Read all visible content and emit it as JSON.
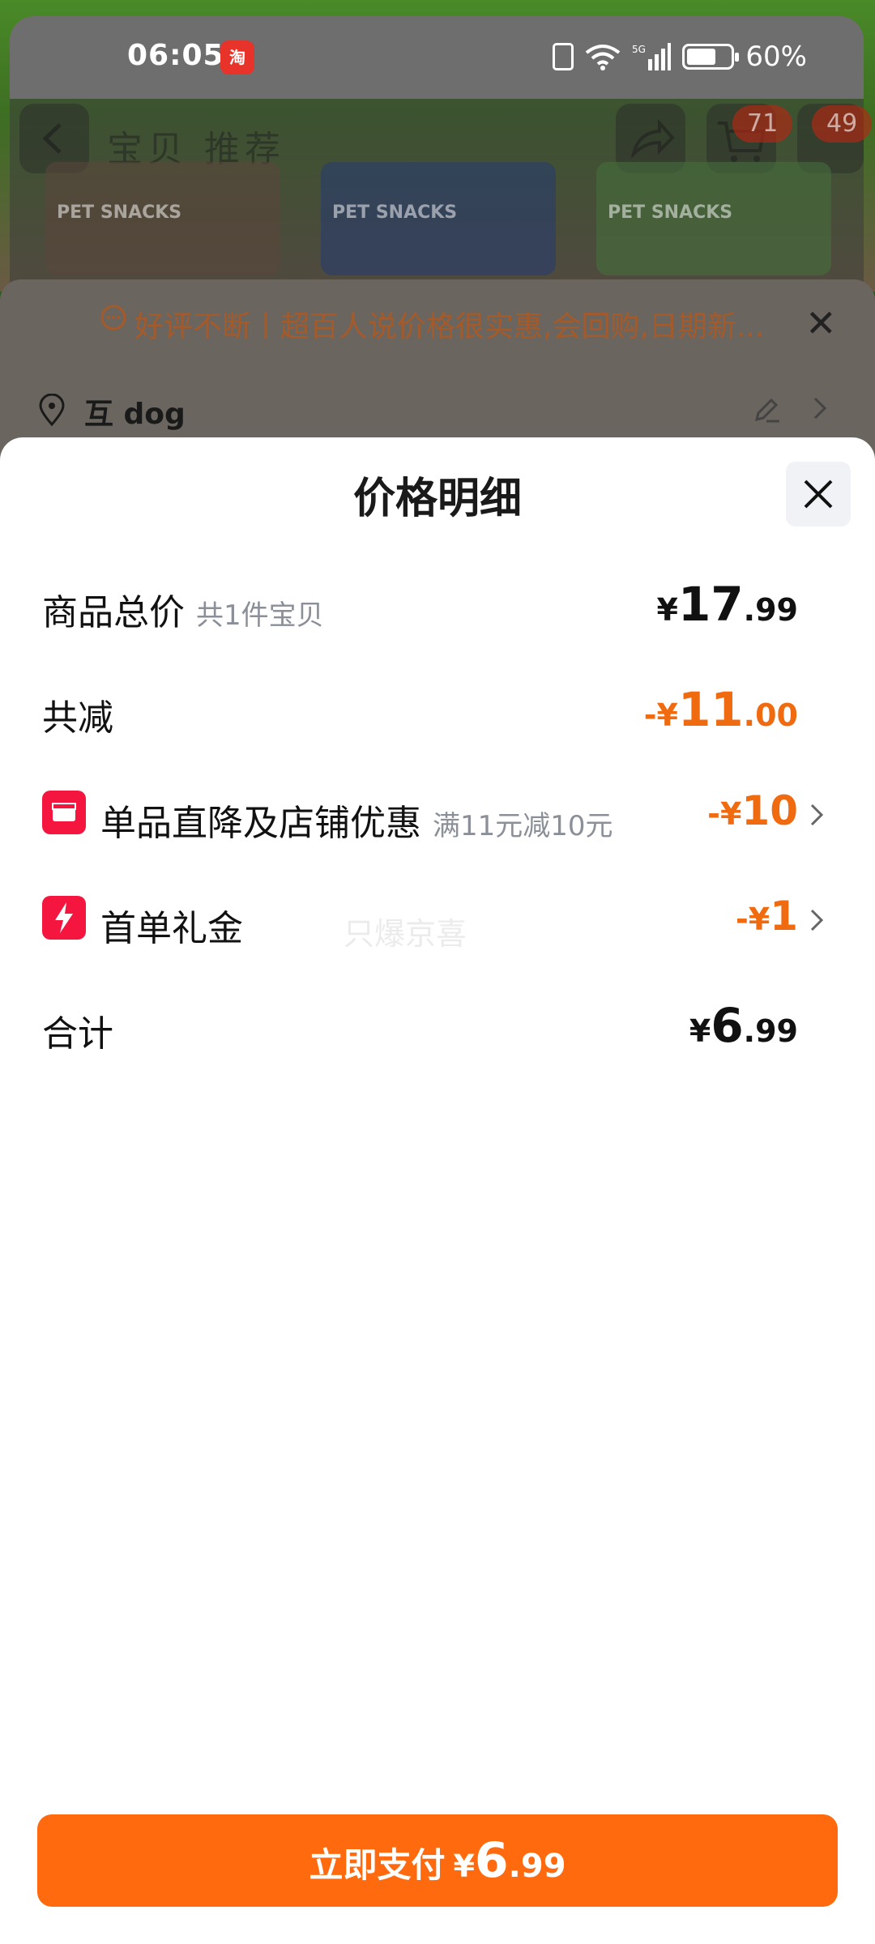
{
  "status_bar": {
    "time": "06:05",
    "app_icon_text": "淘",
    "network": "5G",
    "battery": "60%"
  },
  "background": {
    "nav_title": "宝贝 推荐",
    "cart_badge": "71",
    "msg_badge": "49",
    "product_labels": [
      "PET SNACKS",
      "PET SNACKS",
      "PET SNACKS"
    ],
    "review_banner": "好评不断丨超百人说价格很实惠,会回购,日期新...",
    "address": "互 dog"
  },
  "sheet": {
    "title": "价格明细",
    "rows": {
      "subtotal": {
        "label": "商品总价",
        "sub": "共1件宝贝",
        "currency": "¥",
        "int": "17",
        "dec": ".99"
      },
      "discount_total": {
        "label": "共减",
        "prefix": "-",
        "currency": "¥",
        "int": "11",
        "dec": ".00"
      },
      "store_coupon": {
        "label": "单品直降及店铺优惠",
        "sub": "满11元减10元",
        "prefix": "-",
        "currency": "¥",
        "int": "10"
      },
      "first_order": {
        "label": "首单礼金",
        "prefix": "-",
        "currency": "¥",
        "int": "1"
      },
      "total": {
        "label": "合计",
        "currency": "¥",
        "int": "6",
        "dec": ".99"
      }
    },
    "watermark": "只爆京喜"
  },
  "pay_button": {
    "label": "立即支付",
    "currency": "¥",
    "int": "6",
    "dec": ".99"
  },
  "colors": {
    "accent": "#ff6a0f",
    "discount": "#f06a0f",
    "coupon_icon": "#f5163f"
  }
}
